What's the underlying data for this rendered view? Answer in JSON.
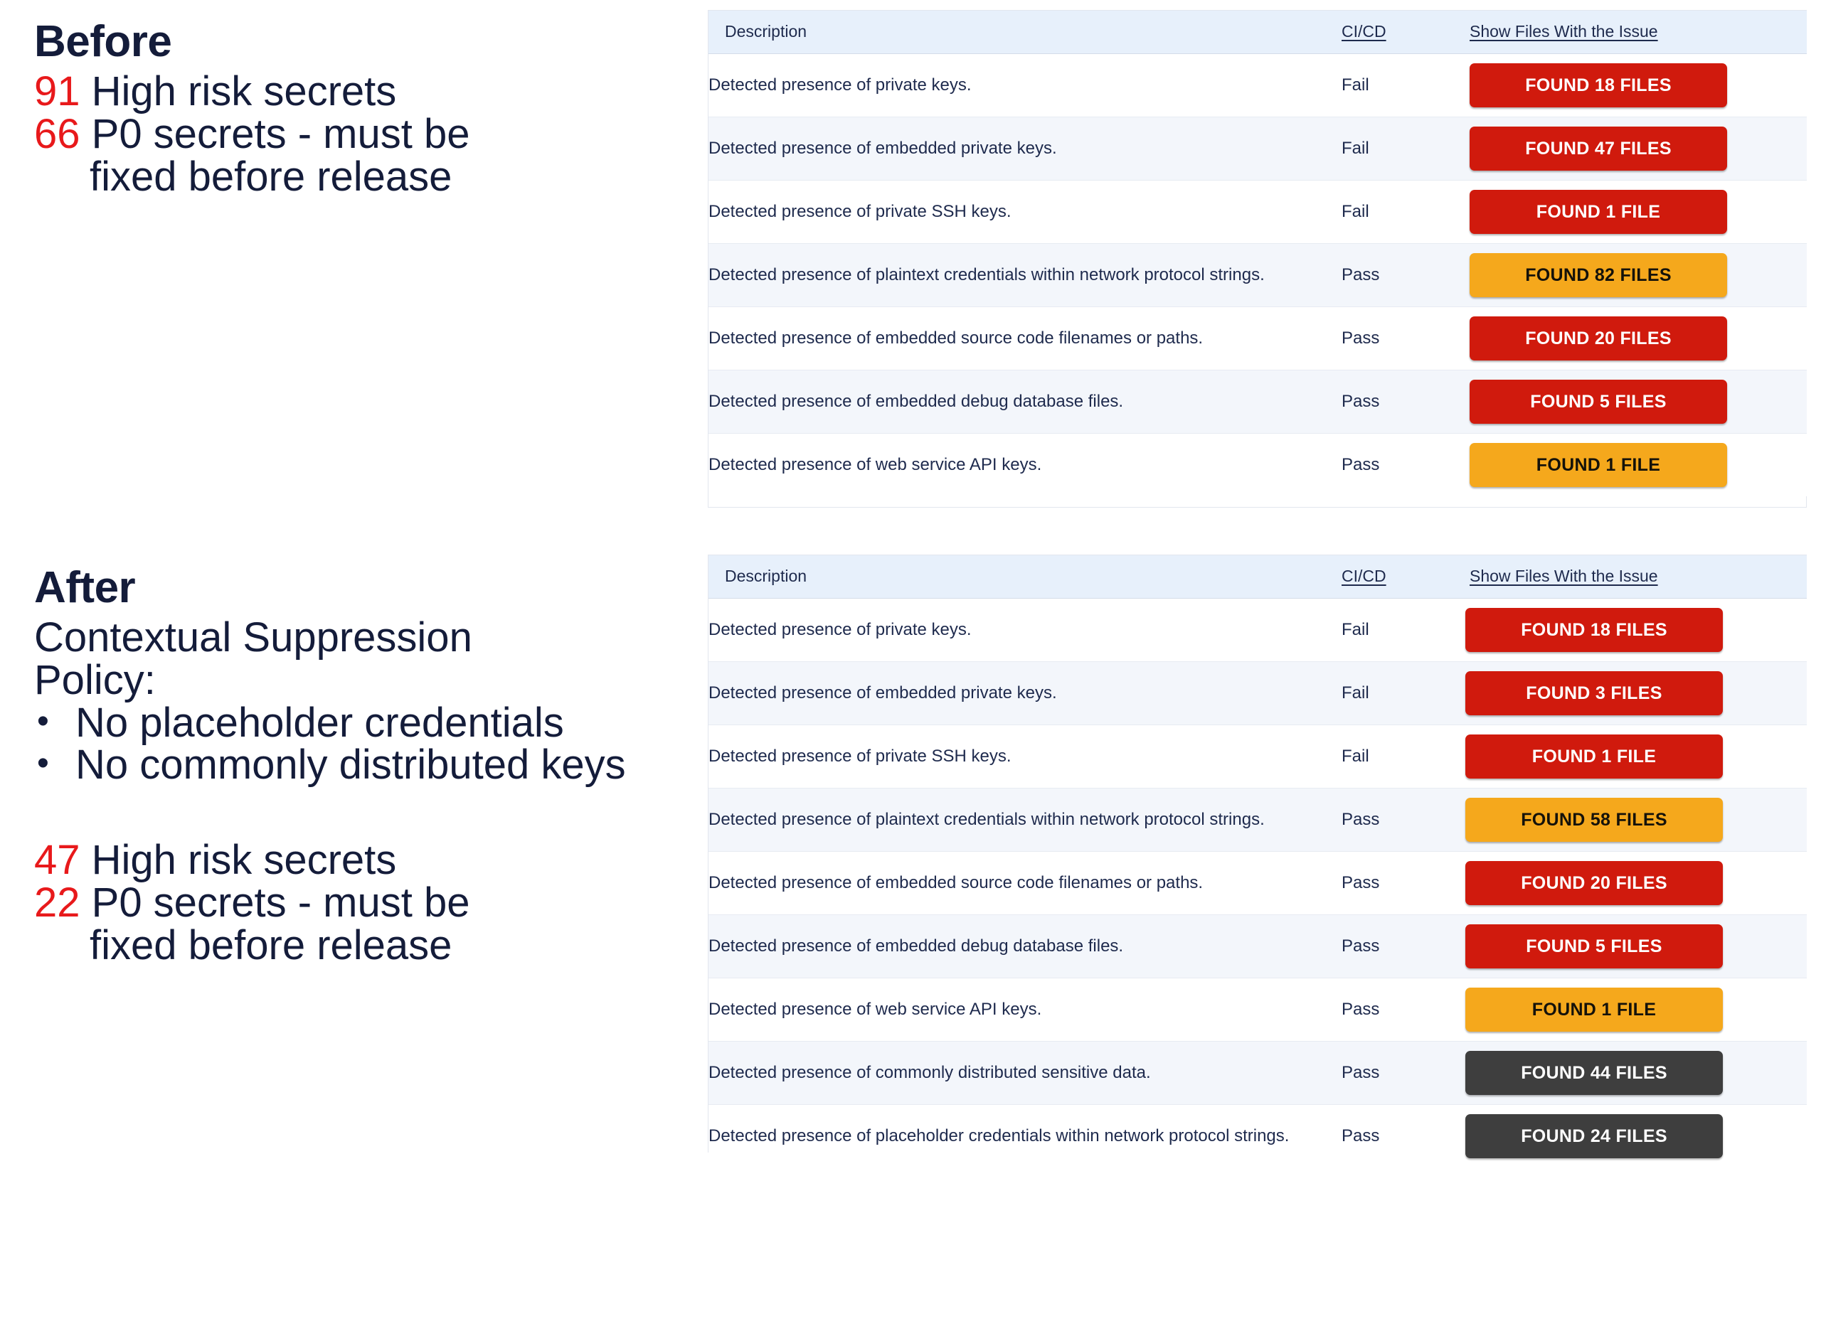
{
  "left": {
    "before": {
      "heading": "Before",
      "stats": [
        {
          "num": "91",
          "text": " High risk secrets",
          "wrap": null
        },
        {
          "num": "66",
          "text": " P0 secrets - must be",
          "wrap": "fixed before release"
        }
      ]
    },
    "after": {
      "heading": "After",
      "policy_title_line1": "Contextual Suppression",
      "policy_title_line2": "Policy:",
      "policy_items": [
        "No placeholder credentials",
        "No commonly distributed keys"
      ],
      "stats": [
        {
          "num": "47",
          "text": " High risk secrets",
          "wrap": null
        },
        {
          "num": "22",
          "text": " P0 secrets - must be",
          "wrap": "fixed before release"
        }
      ]
    }
  },
  "colors": {
    "accent_red": "#e8191b",
    "badge_red": "#d01a0d",
    "badge_orange": "#f5a81c",
    "badge_gray": "#3e3e3e",
    "header_bg": "#e7f0fb",
    "text_navy": "#1e2a4d"
  },
  "table_before": {
    "columns": [
      "Description",
      "CI/CD",
      "Show Files With the Issue"
    ],
    "rows": [
      {
        "description": "Detected presence of private keys.",
        "cicd": "Fail",
        "badge": "FOUND 18  FILES",
        "badge_color": "red"
      },
      {
        "description": "Detected presence of embedded private keys.",
        "cicd": "Fail",
        "badge": "FOUND 47  FILES",
        "badge_color": "red"
      },
      {
        "description": "Detected presence of private SSH keys.",
        "cicd": "Fail",
        "badge": "FOUND 1  FILE",
        "badge_color": "red"
      },
      {
        "description": "Detected presence of plaintext credentials within network protocol strings.",
        "cicd": "Pass",
        "badge": "FOUND 82 FILES",
        "badge_color": "orange"
      },
      {
        "description": "Detected presence of embedded source code filenames or paths.",
        "cicd": "Pass",
        "badge": "FOUND 20  FILES",
        "badge_color": "red"
      },
      {
        "description": "Detected presence of embedded debug database files.",
        "cicd": "Pass",
        "badge": "FOUND 5  FILES",
        "badge_color": "red"
      },
      {
        "description": "Detected presence of web service API keys.",
        "cicd": "Pass",
        "badge": "FOUND 1  FILE",
        "badge_color": "orange"
      }
    ]
  },
  "table_after": {
    "columns": [
      "Description",
      "CI/CD",
      "Show Files With the Issue"
    ],
    "rows": [
      {
        "description": "Detected presence of private keys.",
        "cicd": "Fail",
        "badge": "FOUND 18 FILES",
        "badge_color": "red"
      },
      {
        "description": "Detected presence of embedded private keys.",
        "cicd": "Fail",
        "badge": "FOUND 3 FILES",
        "badge_color": "red"
      },
      {
        "description": "Detected presence of private SSH keys.",
        "cicd": "Fail",
        "badge": "FOUND 1 FILE",
        "badge_color": "red"
      },
      {
        "description": "Detected presence of plaintext credentials within network protocol strings.",
        "cicd": "Pass",
        "badge": "FOUND 58 FILES",
        "badge_color": "orange"
      },
      {
        "description": "Detected presence of embedded source code filenames or paths.",
        "cicd": "Pass",
        "badge": "FOUND 20 FILES",
        "badge_color": "red"
      },
      {
        "description": "Detected presence of embedded debug database files.",
        "cicd": "Pass",
        "badge": "FOUND 5 FILES",
        "badge_color": "red"
      },
      {
        "description": "Detected presence of web service API keys.",
        "cicd": "Pass",
        "badge": "FOUND 1 FILE",
        "badge_color": "orange"
      },
      {
        "description": "Detected presence of commonly distributed sensitive data.",
        "cicd": "Pass",
        "badge": "FOUND 44 FILES",
        "badge_color": "gray"
      },
      {
        "description": "Detected presence of placeholder credentials within network protocol strings.",
        "cicd": "Pass",
        "badge": "FOUND 24 FILES",
        "badge_color": "gray"
      }
    ]
  }
}
